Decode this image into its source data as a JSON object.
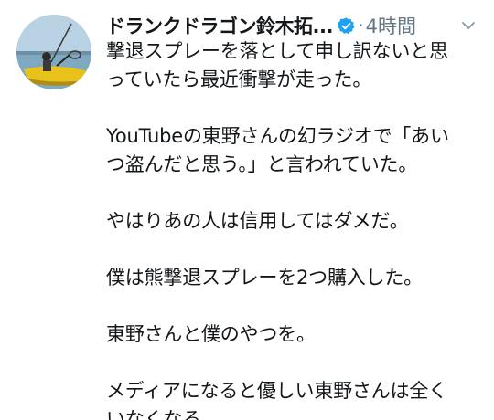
{
  "tweet": {
    "display_name": "ドランクドラゴン鈴木拓...",
    "separator": "·",
    "timestamp": "4時間",
    "paragraphs": [
      "撃退スプレーを落として申し訳ないと思\nっていたら最近衝撃が走った。",
      "YouTubeの東野さんの幻ラジオで「あい\nつ盗んだと思う。」と言われていた。",
      "やはりあの人は信用してはダメだ。",
      "僕は熊撃退スプレーを2つ購入した。",
      "東野さんと僕のやつを。",
      "メディアになると優しい東野さんは全く\nいなくなる。"
    ]
  },
  "icons": {
    "verified": "verified-badge-icon",
    "menu": "chevron-down-icon"
  },
  "colors": {
    "text": "#14171a",
    "secondary": "#657786",
    "verified": "#1da1f2"
  }
}
